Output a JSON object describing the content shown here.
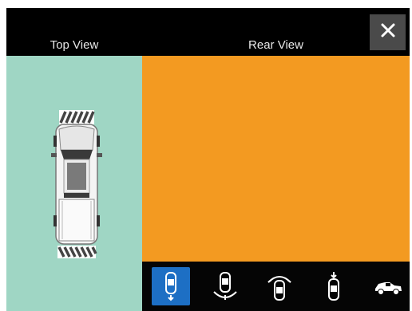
{
  "header": {
    "top_view_label": "Top View",
    "rear_view_label": "Rear View",
    "close_icon": "close-icon"
  },
  "toolbar": {
    "buttons": [
      {
        "icon": "standard-rear-view-icon",
        "active": true
      },
      {
        "icon": "rear-wide-view-icon",
        "active": false
      },
      {
        "icon": "rear-cross-path-view-icon",
        "active": false
      },
      {
        "icon": "hitch-zoom-view-icon",
        "active": false
      },
      {
        "icon": "side-rear-view-icon",
        "active": false
      }
    ]
  },
  "colors": {
    "top_view_bg": "#9fd6c4",
    "rear_view_bg": "#f39a21",
    "active_button": "#1d6fc4",
    "background": "#000000"
  }
}
